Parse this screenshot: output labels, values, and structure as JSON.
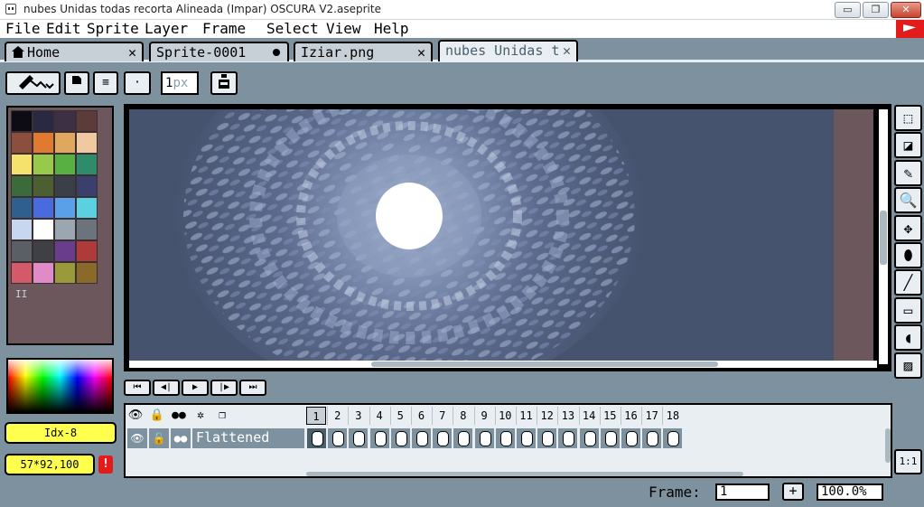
{
  "window": {
    "title": "nubes Unidas todas recorta Alineada (Impar) OSCURA V2.aseprite",
    "min_symbol": "▭",
    "max_symbol": "❐",
    "close_symbol": "✕"
  },
  "menu": [
    "File",
    "Edit",
    "Sprite",
    "Layer",
    "Frame",
    "Select",
    "View",
    "Help"
  ],
  "tabs": [
    {
      "label": "Home",
      "close": "✕"
    },
    {
      "label": "Sprite-0001"
    },
    {
      "label": "Iziar.png",
      "close": "✕"
    },
    {
      "label": "nubes Unidas t",
      "close": "✕"
    }
  ],
  "tool_options": {
    "brush_size": "1",
    "brush_unit": "px",
    "dot_label": "·",
    "list_label": "≡"
  },
  "palette": {
    "colors": [
      "#0c0c12",
      "#292a42",
      "#3d2f44",
      "#5c3b3b",
      "#8c4f3e",
      "#e07a30",
      "#e0a85f",
      "#f0c9a0",
      "#f5e26c",
      "#97c94a",
      "#58b042",
      "#2f8c6a",
      "#3b6b3a",
      "#4c5f30",
      "#3a3f48",
      "#3a3f6b",
      "#2f5f8c",
      "#4a6ae0",
      "#5aa0e8",
      "#5ad0e0",
      "#c7d7f0",
      "#ffffff",
      "#9aa6b0",
      "#6b747c",
      "#5a5f66",
      "#3f3f46",
      "#6a3d8c",
      "#b03a3a",
      "#d45a6a",
      "#e08ac8",
      "#9a9a3a",
      "#8a6a2a"
    ],
    "handle": "II"
  },
  "color_boxes": {
    "index_label": "Idx-8",
    "size_label": "57*92,100",
    "warning": "!"
  },
  "toolbox": [
    {
      "name": "marquee-tool-icon",
      "glyph": "⬚"
    },
    {
      "name": "eraser-tool-icon",
      "glyph": "◪"
    },
    {
      "name": "eyedropper-tool-icon",
      "glyph": "✎"
    },
    {
      "name": "zoom-tool-icon",
      "glyph": "🔍"
    },
    {
      "name": "move-tool-icon",
      "glyph": "✥"
    },
    {
      "name": "fill-tool-icon",
      "glyph": "⬮"
    },
    {
      "name": "line-tool-icon",
      "glyph": "╱"
    },
    {
      "name": "rectangle-tool-icon",
      "glyph": "▭"
    },
    {
      "name": "contour-tool-icon",
      "glyph": "◖"
    },
    {
      "name": "blur-tool-icon",
      "glyph": "▨"
    }
  ],
  "one_to_one": "1:1",
  "playback": [
    "⏮",
    "◀|",
    "▶",
    "|▶",
    "⏭"
  ],
  "timeline": {
    "layer_name": "Flattened",
    "frames": [
      "1",
      "2",
      "3",
      "4",
      "5",
      "6",
      "7",
      "8",
      "9",
      "10",
      "11",
      "12",
      "13",
      "14",
      "15",
      "16",
      "17",
      "18"
    ],
    "current_frame": "1",
    "header_icons": [
      {
        "name": "visibility-header-icon",
        "glyph": "👁"
      },
      {
        "name": "lock-header-icon",
        "glyph": "🔒"
      },
      {
        "name": "continuous-header-icon",
        "glyph": "●●"
      },
      {
        "name": "settings-header-icon",
        "glyph": "✲"
      },
      {
        "name": "onion-skin-header-icon",
        "glyph": "❐"
      }
    ]
  },
  "status": {
    "frame_label": "Frame:",
    "frame_value": "1",
    "add_label": "+",
    "zoom_value": "100.0%"
  }
}
